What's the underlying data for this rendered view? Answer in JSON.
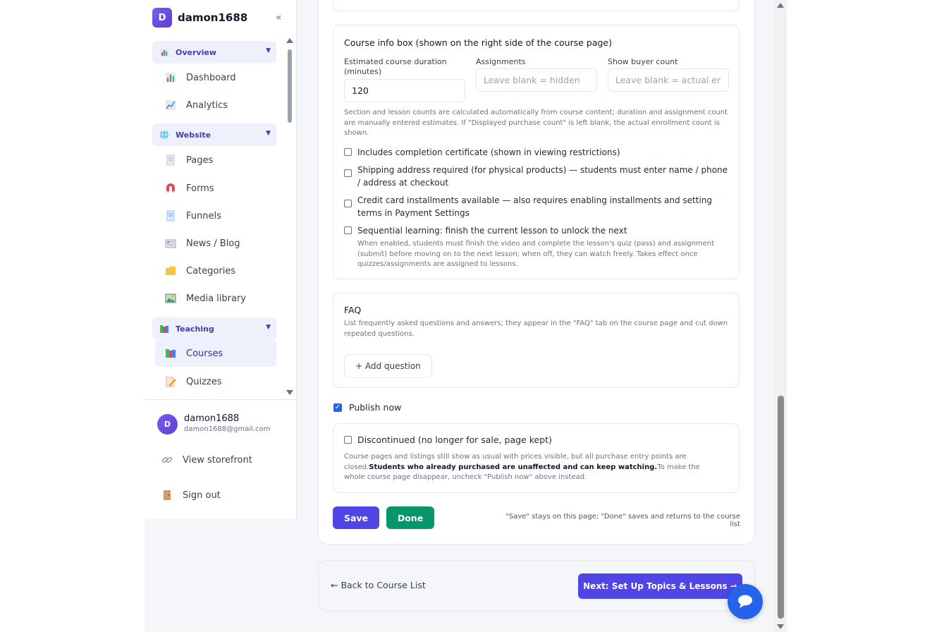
{
  "brand": {
    "initial": "D",
    "name": "damon1688",
    "collapse_glyph": "«"
  },
  "sidebar": {
    "groups": [
      {
        "label": "Overview",
        "icon": "bar-chart-icon"
      },
      {
        "label": "Website",
        "icon": "globe-icon"
      },
      {
        "label": "Teaching",
        "icon": "books-icon"
      }
    ],
    "items": [
      {
        "label": "Dashboard",
        "icon": "bar-chart-icon"
      },
      {
        "label": "Analytics",
        "icon": "trend-chart-icon"
      },
      {
        "label": "Pages",
        "icon": "page-icon"
      },
      {
        "label": "Forms",
        "icon": "magnet-icon"
      },
      {
        "label": "Funnels",
        "icon": "funnel-icon"
      },
      {
        "label": "News / Blog",
        "icon": "newspaper-icon"
      },
      {
        "label": "Categories",
        "icon": "folder-icon"
      },
      {
        "label": "Media library",
        "icon": "image-icon"
      },
      {
        "label": "Courses",
        "icon": "books-icon"
      },
      {
        "label": "Quizzes",
        "icon": "pencil-icon"
      }
    ],
    "active_item": "Courses"
  },
  "user": {
    "initial": "D",
    "name": "damon1688",
    "email": "damon1688@gmail.com"
  },
  "footer_links": [
    {
      "label": "View storefront",
      "icon": "link-icon"
    },
    {
      "label": "Sign out",
      "icon": "door-icon"
    }
  ],
  "course_info": {
    "title": "Course info box (shown on the right side of the course page)",
    "duration_label": "Estimated course duration (minutes)",
    "duration_value": "120",
    "assignments_label": "Assignments",
    "assignments_placeholder": "Leave blank = hidden",
    "buyer_label": "Show buyer count",
    "buyer_placeholder": "Leave blank = actual er",
    "help": "Section and lesson counts are calculated automatically from course content; duration and assignment count are manually entered estimates. If \"Displayed purchase count\" is left blank, the actual enrollment count is shown.",
    "options": [
      "Includes completion certificate (shown in viewing restrictions)",
      "Shipping address required (for physical products) — students must enter name / phone / address at checkout",
      "Credit card installments available — also requires enabling installments and setting terms in Payment Settings",
      "Sequential learning: finish the current lesson to unlock the next"
    ],
    "sequential_help": "When enabled, students must finish the video and complete the lesson's quiz (pass) and assignment (submit) before moving on to the next lesson; when off, they can watch freely. Takes effect once quizzes/assignments are assigned to lessons."
  },
  "faq": {
    "title": "FAQ",
    "help": "List frequently asked questions and answers; they appear in the \"FAQ\" tab on the course page and cut down repeated questions.",
    "add_label": "+ Add question"
  },
  "publish": {
    "label": "Publish now",
    "checked_glyph": "✓"
  },
  "discontinued": {
    "label": "Discontinued (no longer for sale, page kept)",
    "help_before": "Course pages and listings still show as usual with prices visible, but all purchase entry points are closed.",
    "help_bold": "Students who already purchased are unaffected and can keep watching.",
    "help_after": "To make the whole course page disappear, uncheck \"Publish now\" above instead."
  },
  "actions": {
    "save": "Save",
    "done": "Done",
    "hint": "\"Save\" stays on this page; \"Done\" saves and returns to the course list"
  },
  "bottom": {
    "back": "← Back to Course List",
    "next": "Next: Set Up Topics & Lessons →"
  },
  "colors": {
    "accent": "#4f46e5",
    "done": "#059669",
    "chat": "#2563eb"
  }
}
